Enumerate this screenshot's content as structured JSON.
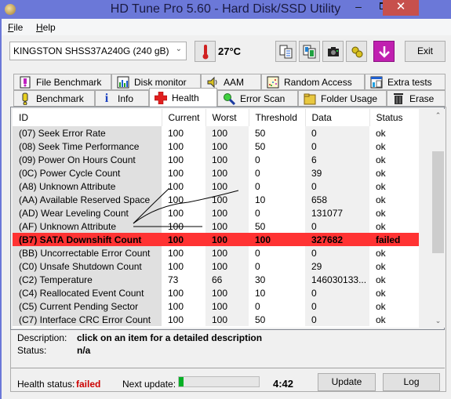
{
  "window": {
    "title": "HD Tune Pro 5.60 - Hard Disk/SSD Utility",
    "minimize_label": "–",
    "close_label": "✕"
  },
  "menu": [
    {
      "label": "File",
      "accel": "F",
      "rest": "ile"
    },
    {
      "label": "Help",
      "accel": "H",
      "rest": "elp"
    }
  ],
  "toolbar": {
    "drive": "KINGSTON SHSS37A240G (240 gB)",
    "temperature": "27°C",
    "exit_label": "Exit",
    "icons": [
      "copy-text-icon",
      "copy-screenshot-icon",
      "camera-icon",
      "options-icon",
      "save-download-icon"
    ]
  },
  "tabs": {
    "row1": [
      {
        "label": "File Benchmark",
        "icon": "file-benchmark-icon"
      },
      {
        "label": "Disk monitor",
        "icon": "disk-monitor-icon"
      },
      {
        "label": "AAM",
        "icon": "speaker-icon"
      },
      {
        "label": "Random Access",
        "icon": "random-access-icon"
      },
      {
        "label": "Extra tests",
        "icon": "extra-tests-icon"
      }
    ],
    "row2": [
      {
        "label": "Benchmark",
        "icon": "exclamation-icon"
      },
      {
        "label": "Info",
        "icon": "info-icon"
      },
      {
        "label": "Health",
        "icon": "red-cross-icon",
        "active": true
      },
      {
        "label": "Error Scan",
        "icon": "magnifier-icon"
      },
      {
        "label": "Folder Usage",
        "icon": "folder-icon"
      },
      {
        "label": "Erase",
        "icon": "trash-icon"
      }
    ]
  },
  "table": {
    "columns": [
      "ID",
      "Current",
      "Worst",
      "Threshold",
      "Data",
      "Status"
    ],
    "rows": [
      {
        "id": "(07) Seek Error Rate",
        "current": "100",
        "worst": "100",
        "threshold": "50",
        "data": "0",
        "status": "ok"
      },
      {
        "id": "(08) Seek Time Performance",
        "current": "100",
        "worst": "100",
        "threshold": "50",
        "data": "0",
        "status": "ok"
      },
      {
        "id": "(09) Power On Hours Count",
        "current": "100",
        "worst": "100",
        "threshold": "0",
        "data": "6",
        "status": "ok"
      },
      {
        "id": "(0C) Power Cycle Count",
        "current": "100",
        "worst": "100",
        "threshold": "0",
        "data": "39",
        "status": "ok"
      },
      {
        "id": "(A8) Unknown Attribute",
        "current": "100",
        "worst": "100",
        "threshold": "0",
        "data": "0",
        "status": "ok"
      },
      {
        "id": "(AA) Available Reserved Space",
        "current": "100",
        "worst": "100",
        "threshold": "10",
        "data": "658",
        "status": "ok"
      },
      {
        "id": "(AD) Wear Leveling Count",
        "current": "100",
        "worst": "100",
        "threshold": "0",
        "data": "131077",
        "status": "ok"
      },
      {
        "id": "(AF) Unknown Attribute",
        "current": "100",
        "worst": "100",
        "threshold": "50",
        "data": "0",
        "status": "ok"
      },
      {
        "id": "(B7) SATA Downshift Count",
        "current": "100",
        "worst": "100",
        "threshold": "100",
        "data": "327682",
        "status": "failed",
        "failed": true
      },
      {
        "id": "(BB) Uncorrectable Error Count",
        "current": "100",
        "worst": "100",
        "threshold": "0",
        "data": "0",
        "status": "ok"
      },
      {
        "id": "(C0) Unsafe Shutdown Count",
        "current": "100",
        "worst": "100",
        "threshold": "0",
        "data": "29",
        "status": "ok"
      },
      {
        "id": "(C2) Temperature",
        "current": "73",
        "worst": "66",
        "threshold": "30",
        "data": "146030133...",
        "status": "ok"
      },
      {
        "id": "(C4) Reallocated Event Count",
        "current": "100",
        "worst": "100",
        "threshold": "10",
        "data": "0",
        "status": "ok"
      },
      {
        "id": "(C5) Current Pending Sector",
        "current": "100",
        "worst": "100",
        "threshold": "0",
        "data": "0",
        "status": "ok"
      },
      {
        "id": "(C7) Interface CRC Error Count",
        "current": "100",
        "worst": "100",
        "threshold": "50",
        "data": "0",
        "status": "ok"
      }
    ]
  },
  "details": {
    "description_label": "Description:",
    "description_value": "click on an item for a detailed description",
    "status_label": "Status:",
    "status_value": "n/a"
  },
  "footer": {
    "health_label": "Health status:",
    "health_value": "failed",
    "next_update_label": "Next update:",
    "next_update_progress_percent": 6,
    "next_update_time": "4:42",
    "update_button": "Update",
    "log_button": "Log"
  },
  "colors": {
    "failed_row": "#ff3333",
    "failed_text": "#cc0000",
    "progress": "#06b025",
    "titlebar": "#6b78d8"
  }
}
